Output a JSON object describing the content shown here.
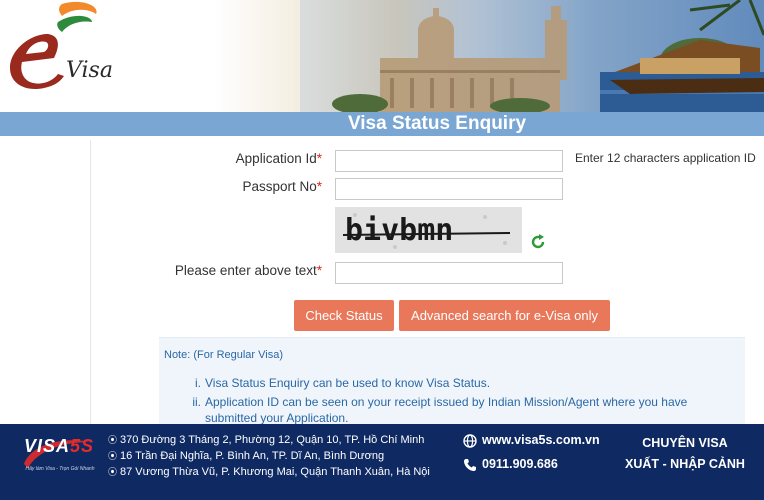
{
  "header": {
    "logo_text": "Visa",
    "title": "Visa Status Enquiry"
  },
  "form": {
    "application_id_label": "Application Id",
    "passport_no_label": "Passport No",
    "captcha_label": "Please enter above text",
    "required_mark": "*",
    "application_id_hint": "Enter 12 characters application ID",
    "captcha_text": "bivbmn",
    "application_id_value": "",
    "passport_no_value": "",
    "captcha_value": ""
  },
  "buttons": {
    "check_status": "Check Status",
    "advanced_search": "Advanced search for e-Visa only"
  },
  "notes": {
    "title": "Note: (For Regular Visa)",
    "items": [
      {
        "num": "i.",
        "text": "Visa Status Enquiry can be used to know Visa Status."
      },
      {
        "num": "ii.",
        "line1": "Application ID can be seen on your receipt issued by Indian Mission/Agent where you have",
        "line2": "submitted your Application."
      }
    ]
  },
  "footer": {
    "logo": "VISA",
    "logo_accent": "5S",
    "logo_slogan": "Hãy làm Visa - Trọn Gói Nhanh",
    "addresses": [
      "370 Đường 3 Tháng 2, Phường 12, Quận 10, TP. Hồ Chí Minh",
      "16 Trần Đại Nghĩa, P. Bình An, TP. Dĩ An, Bình Dương",
      "87 Vương Thừa Vũ, P. Khương Mai, Quận Thanh Xuân, Hà Nội"
    ],
    "website": "www.visa5s.com.vn",
    "phone": "0911.909.686",
    "slogan_line1": "CHUYÊN VISA",
    "slogan_line2": "XUẤT - NHẬP CẢNH"
  },
  "colors": {
    "title_bar": "#7aa6d4",
    "button": "#e9785b",
    "footer": "#0f2a63",
    "required": "#d9261c",
    "note_text": "#2a68a6"
  }
}
